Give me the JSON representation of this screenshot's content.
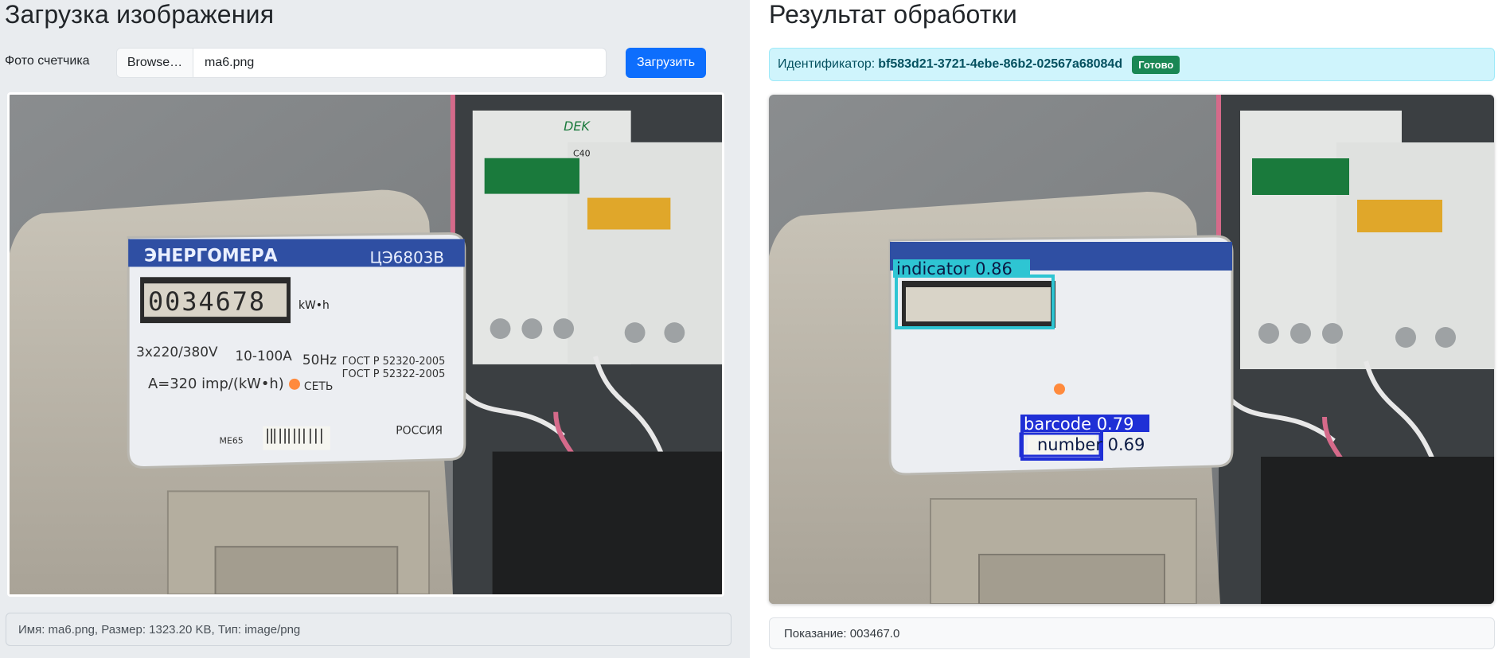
{
  "upload": {
    "heading": "Загрузка изображения",
    "field_label": "Фото счетчика",
    "browse_label": "Browse…",
    "file_name": "ma6.png",
    "upload_button": "Загрузить",
    "file_info": "Имя: ma6.png, Размер: 1323.20 KB, Тип: image/png"
  },
  "result": {
    "heading": "Результат обработки",
    "id_label": "Идентификатор:",
    "id_value": "bf583d21-3721-4ebe-86b2-02567a68084d",
    "status": "Готово",
    "reading": "Показание: 003467.0"
  },
  "meter_photo": {
    "brand": "ЭНЕРГОМЕРА",
    "model": "ЦЭ6803В",
    "display_digits": "0034678",
    "unit": "kW•h",
    "voltage": "3x220/380V",
    "current": "10-100A",
    "freq": "50Hz",
    "gost1": "ГОСТ Р 52320-2005",
    "gost2": "ГОСТ Р 52322-2005",
    "constant": "A=320 imp/(kW•h)",
    "led_label": "СЕТЬ",
    "country": "РОССИЯ",
    "mark": "МЕ65",
    "breaker_rating": "C40",
    "breaker_brand": "DEK"
  },
  "detections": [
    {
      "label": "indicator 0.86",
      "color": "#2ec5d3"
    },
    {
      "label": "barcode 0.79",
      "color": "#1f2fd6"
    },
    {
      "label": "number 0.69",
      "color": "#1f2fd6"
    }
  ]
}
